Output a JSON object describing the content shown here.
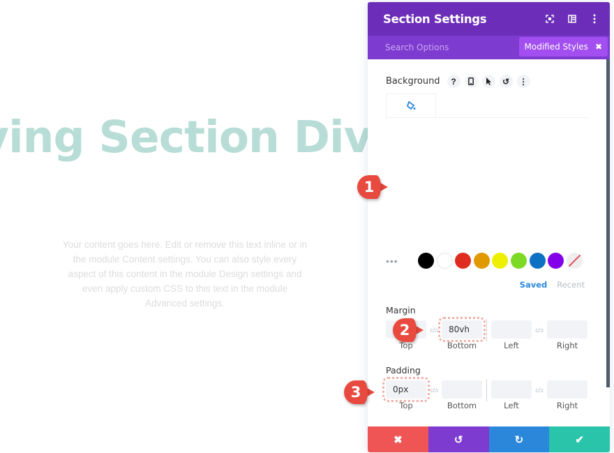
{
  "page": {
    "hero_title": "ving Section Divic",
    "body_text": "Your content goes here. Edit or remove this text inline or in the module Content settings. You can also style every aspect of this content in the module Design settings and even apply custom CSS to this text in the module Advanced settings."
  },
  "panel": {
    "title": "Section Settings",
    "header_icons": [
      "expand-icon",
      "split-view-icon",
      "more-vertical-icon"
    ],
    "search_placeholder": "Search Options",
    "modified_styles_label": "Modified Styles",
    "modified_styles_close": "✖",
    "background": {
      "label": "Background",
      "option_icons": [
        "?",
        "▯",
        "➤",
        "↺",
        "⋮"
      ],
      "tab_icon": "paint-bucket-icon"
    },
    "swatches": {
      "more": "•••",
      "colors": [
        "#000000",
        "#ffffff",
        "#e02b20",
        "#e09900",
        "#edf000",
        "#7cda24",
        "#0c71c3",
        "#8300e9"
      ],
      "saved_label": "Saved",
      "recent_label": "Recent"
    },
    "margin": {
      "label": "Margin",
      "fields": [
        {
          "caption": "Top",
          "value": ""
        },
        {
          "caption": "Bottom",
          "value": "80vh"
        },
        {
          "caption": "Left",
          "value": ""
        },
        {
          "caption": "Right",
          "value": ""
        }
      ]
    },
    "padding": {
      "label": "Padding",
      "fields": [
        {
          "caption": "Top",
          "value": "0px"
        },
        {
          "caption": "Bottom",
          "value": ""
        },
        {
          "caption": "Left",
          "value": ""
        },
        {
          "caption": "Right",
          "value": ""
        }
      ]
    },
    "footer": {
      "cancel": "✖",
      "undo": "↺",
      "redo": "↻",
      "save": "✔",
      "colors": [
        "#ef5555",
        "#7e3bd0",
        "#2b87da",
        "#29c4a9"
      ]
    },
    "accent": "#6c2eb9"
  },
  "markers": [
    "1",
    "2",
    "3"
  ]
}
